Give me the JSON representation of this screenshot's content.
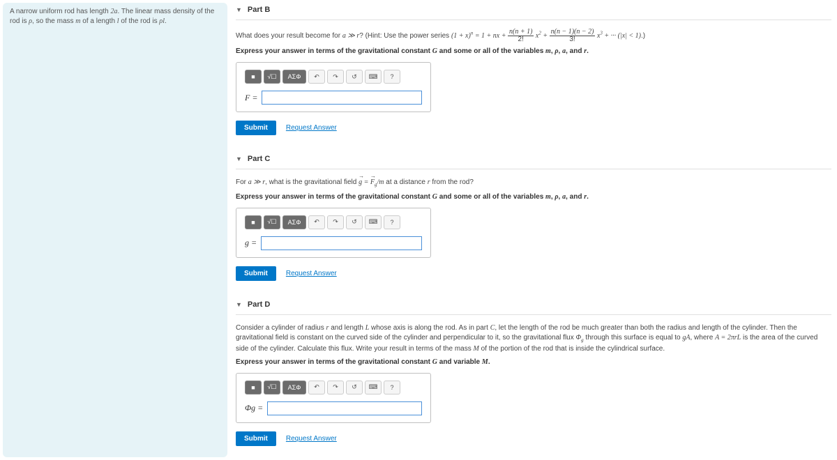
{
  "left_context": {
    "text_a": "A narrow uniform rod has length ",
    "text_b": ". The linear mass density of the rod is ",
    "text_c": ", so the mass ",
    "text_d": " of a length ",
    "text_e": " of the rod is ",
    "text_f": "."
  },
  "partB": {
    "title": "Part B",
    "prompt_a": "What does your result become for ",
    "prompt_b": "? (Hint: Use the power series ",
    "prompt_c": ".)",
    "express": "Express your answer in terms of the gravitational constant ",
    "express_b": " and some or all of the variables ",
    "express_c": ", ",
    "express_d": ", ",
    "express_e": ", and ",
    "express_f": ".",
    "label": "F =",
    "submit": "Submit",
    "request": "Request Answer"
  },
  "partC": {
    "title": "Part C",
    "prompt_a": "For ",
    "prompt_b": ", what is the gravitational field ",
    "prompt_c": " at a distance ",
    "prompt_d": " from the rod?",
    "express": "Express your answer in terms of the gravitational constant ",
    "express_b": " and some or all of the variables ",
    "express_c": ", ",
    "express_d": ", ",
    "express_e": ", and ",
    "express_f": ".",
    "label": "g =",
    "submit": "Submit",
    "request": "Request Answer"
  },
  "partD": {
    "title": "Part D",
    "prompt_a": "Consider a cylinder of radius ",
    "prompt_b": " and length ",
    "prompt_c": " whose axis is along the rod. As in part ",
    "prompt_d": ", let the length of the rod be much greater than both the radius and length of the cylinder. Then the gravitational field is constant on the curved side of the cylinder and perpendicular to it, so the gravitational flux ",
    "prompt_e": " through this surface is equal to ",
    "prompt_f": ", where ",
    "prompt_g": " is the area of the curved side of the cylinder. Calculate this flux. Write your result in terms of the mass ",
    "prompt_h": " of the portion of the rod that is inside the cylindrical surface.",
    "express": "Express your answer in terms of the gravitational constant ",
    "express_b": " and variable ",
    "express_c": ".",
    "label": "Φg =",
    "submit": "Submit",
    "request": "Request Answer"
  },
  "toolbar": {
    "templates": "■",
    "sqrt": "√☐",
    "greek": "ΑΣΦ",
    "undo": "↶",
    "redo": "↷",
    "reset": "↺",
    "keyboard": "⌨",
    "help": "?"
  }
}
